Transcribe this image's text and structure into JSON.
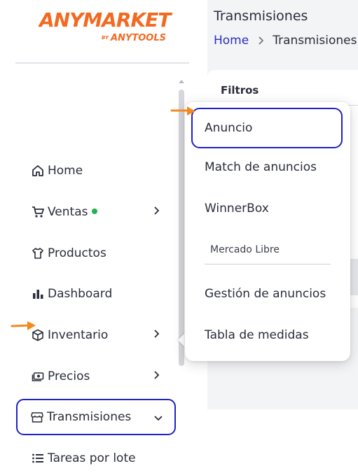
{
  "brand": {
    "name": "ANYMARKET",
    "by": "BY",
    "sub": "ANYTOOLS",
    "color": "#f26a21"
  },
  "header": {
    "title": "Transmisiones",
    "breadcrumb": {
      "home": "Home",
      "current": "Transmisiones"
    }
  },
  "sidebar": {
    "items": [
      {
        "label": "Home",
        "icon": "home-icon"
      },
      {
        "label": "Ventas",
        "icon": "cart-icon",
        "status_dot": "green",
        "has_chevron": true
      },
      {
        "label": "Productos",
        "icon": "shirt-icon"
      },
      {
        "label": "Dashboard",
        "icon": "bar-chart-icon"
      },
      {
        "label": "Inventario",
        "icon": "box-icon",
        "has_chevron": true
      },
      {
        "label": "Precios",
        "icon": "money-icon",
        "has_chevron": true
      },
      {
        "label": "Transmisiones",
        "icon": "store-icon",
        "has_chevron": true,
        "active": true
      },
      {
        "label": "Tareas por lote",
        "icon": "list-icon"
      }
    ]
  },
  "filters": {
    "title": "Filtros"
  },
  "submenu": {
    "items": [
      {
        "label": "Anuncio",
        "selected": true
      },
      {
        "label": "Match de anuncios"
      },
      {
        "label": "WinnerBox"
      }
    ],
    "section_label": "Mercado Libre",
    "section_items": [
      {
        "label": "Gestión de anuncios"
      },
      {
        "label": "Tabla de medidas"
      }
    ]
  },
  "colors": {
    "accent": "#1f21c9",
    "annotation_arrow": "#f5891f",
    "status_green": "#22b24c",
    "link": "#2a2fbf"
  }
}
